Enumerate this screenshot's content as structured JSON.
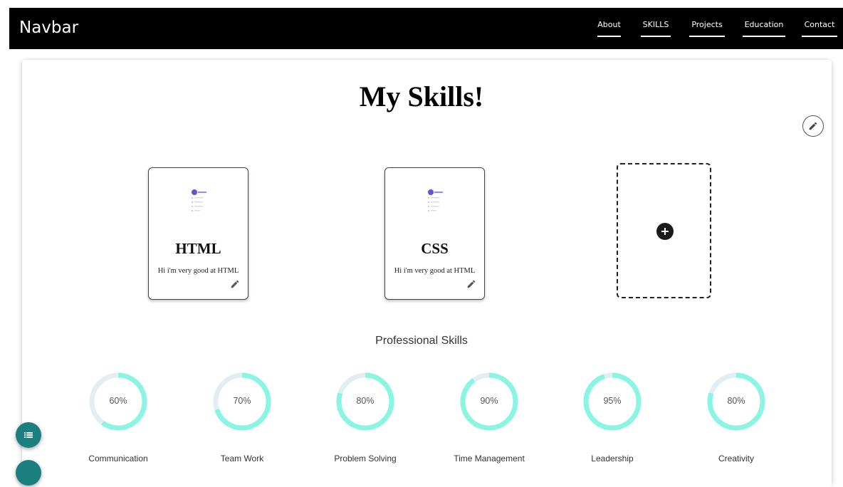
{
  "navbar": {
    "brand": "Navbar",
    "links": [
      {
        "label": "About"
      },
      {
        "label": "SKILLS"
      },
      {
        "label": "Projects"
      },
      {
        "label": "Education"
      },
      {
        "label": "Contact"
      }
    ]
  },
  "main": {
    "title": "My Skills!",
    "edit_icon": "pencil-icon",
    "cards": [
      {
        "title": "HTML",
        "description": "Hi i'm very good at HTML",
        "icon": "pencil-icon"
      },
      {
        "title": "CSS",
        "description": "Hi i'm very good at HTML",
        "icon": "pencil-icon"
      }
    ],
    "add_card_icon": "plus-icon"
  },
  "professional": {
    "heading": "Professional Skills",
    "skills": [
      {
        "name": "Communication",
        "value": "60%",
        "percent": 60
      },
      {
        "name": "Team Work",
        "value": "70%",
        "percent": 70
      },
      {
        "name": "Problem Solving",
        "value": "80%",
        "percent": 80
      },
      {
        "name": "Time Management",
        "value": "90%",
        "percent": 90
      },
      {
        "name": "Leadership",
        "value": "95%",
        "percent": 95
      },
      {
        "name": "Creativity",
        "value": "80%",
        "percent": 80
      }
    ]
  },
  "colors": {
    "navbar_bg": "#000000",
    "gauge_fill": "#8af5e2",
    "gauge_track": "#e2eef2",
    "fab": "#1b7f7f"
  }
}
